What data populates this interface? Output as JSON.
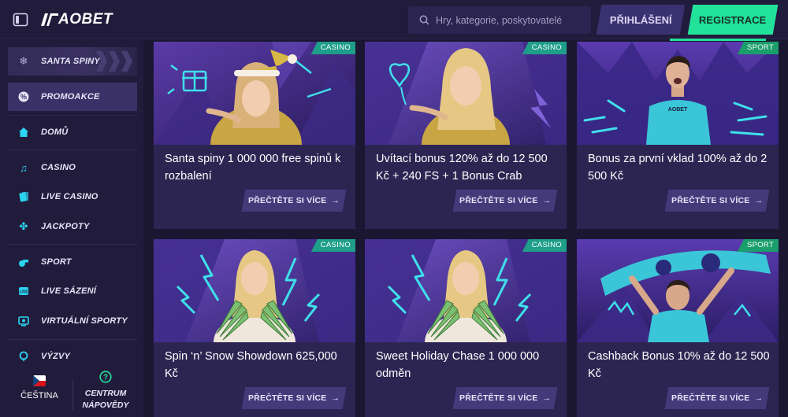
{
  "header": {
    "logo_text": "AOBET",
    "search_placeholder": "Hry, kategorie, poskytovatelé",
    "login_label": "PŘIHLÁŠENÍ",
    "register_label": "REGISTRACE"
  },
  "sidebar": {
    "items": [
      {
        "label": "SANTA SPINY",
        "icon": "snowflake-icon"
      },
      {
        "label": "PROMOAKCE",
        "icon": "percent-icon"
      },
      {
        "label": "DOMŮ",
        "icon": "home-icon"
      },
      {
        "label": "CASINO",
        "icon": "music-note-icon"
      },
      {
        "label": "LIVE CASINO",
        "icon": "cards-icon"
      },
      {
        "label": "JACKPOTY",
        "icon": "clover-icon"
      },
      {
        "label": "SPORT",
        "icon": "whistle-icon"
      },
      {
        "label": "LIVE SÁZENÍ",
        "icon": "live-icon"
      },
      {
        "label": "VIRTUÁLNÍ SPORTY",
        "icon": "virtual-icon"
      },
      {
        "label": "VÝZVY",
        "icon": "medal-icon"
      }
    ],
    "language": "ČEŠTINA",
    "help_label": "CENTRUM NÁPOVĚDY"
  },
  "promotions": {
    "more_label": "PŘEČTĚTE SI VÍCE",
    "cards": [
      {
        "badge": "CASINO",
        "title": "Santa spiny 1 000 000 free spinů k rozbalení",
        "image": "woman-santa-hat-gift"
      },
      {
        "badge": "CASINO",
        "title": "Uvítací bonus 120% až do 12 500 Kč + 240 FS + 1 Bonus Crab",
        "image": "woman-heart"
      },
      {
        "badge": "SPORT",
        "title": "Bonus za první vklad 100% až do 2 500 Kč",
        "image": "footballer-celebrating"
      },
      {
        "badge": "CASINO",
        "title": "Spin ‘n’ Snow Showdown 625,000 Kč",
        "image": "woman-cash-fan"
      },
      {
        "badge": "CASINO",
        "title": "Sweet Holiday Chase 1 000 000 odměn",
        "image": "woman-cash-fan"
      },
      {
        "badge": "SPORT",
        "title": "Cashback Bonus 10% až do 12 500 Kč",
        "image": "fan-with-scarf"
      }
    ]
  },
  "colors": {
    "accent_green": "#22e29a",
    "accent_cyan": "#2bd4f0",
    "background": "#1b1733",
    "card": "#2c2552"
  }
}
